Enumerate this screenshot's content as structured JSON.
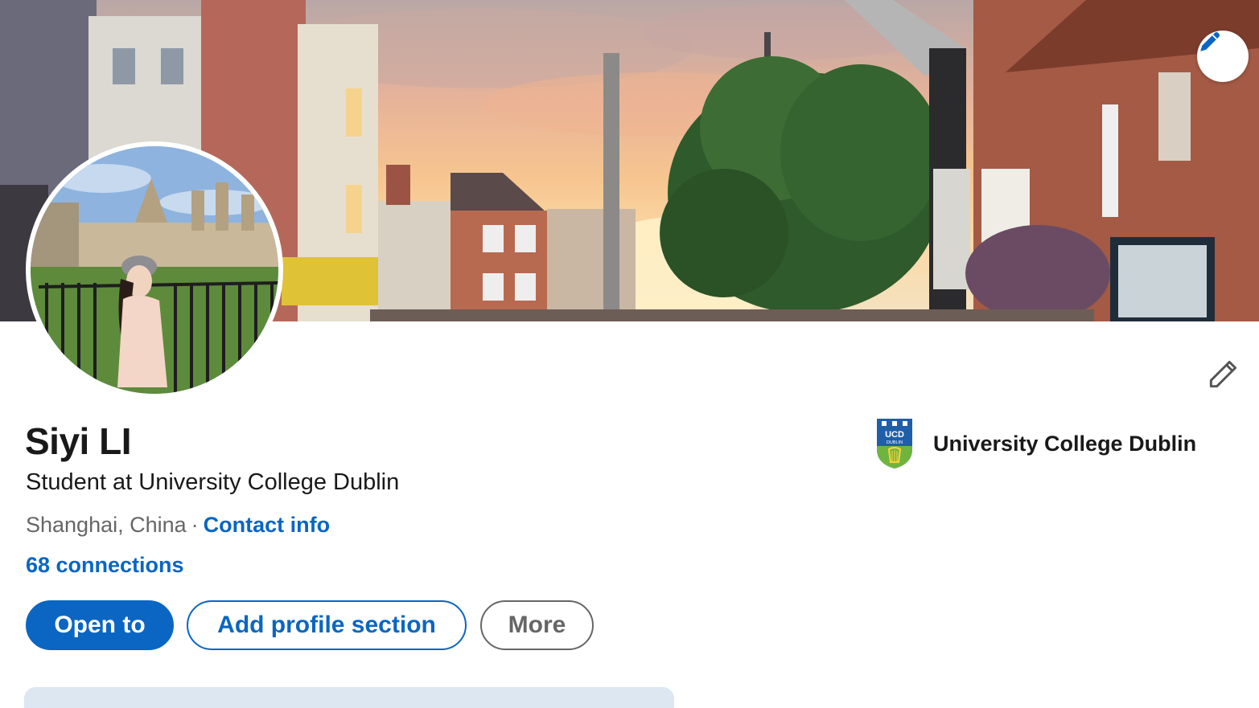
{
  "profile": {
    "name": "Siyi LI",
    "headline": "Student at University College Dublin",
    "location": "Shanghai, China",
    "separator": "·",
    "contact_info_label": "Contact info",
    "connections_label": "68 connections"
  },
  "actions": {
    "open_to_label": "Open to",
    "add_profile_section_label": "Add profile section",
    "more_label": "More"
  },
  "education": {
    "school_name": "University College Dublin",
    "logo_text_top": "UCD",
    "logo_text_bottom": "DUBLIN"
  },
  "icons": {
    "cover_edit": "pencil-icon",
    "intro_edit": "pencil-outline-icon",
    "school_logo": "ucd-crest-icon"
  },
  "colors": {
    "brand_blue": "#0a66c2",
    "text_primary": "#191919",
    "text_secondary": "#666666",
    "card_tint": "#dde7f1"
  }
}
